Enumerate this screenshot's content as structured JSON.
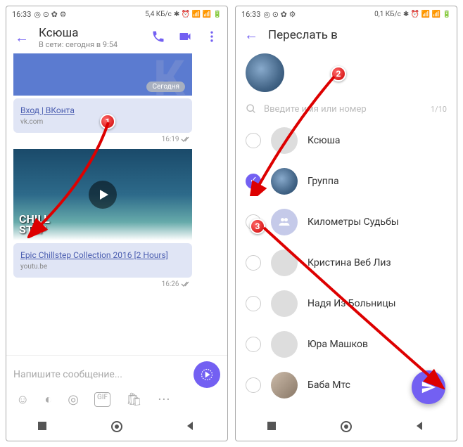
{
  "left": {
    "status": {
      "time": "16:33",
      "net": "5,4 КБ/с"
    },
    "header": {
      "title": "Ксюша",
      "sub": "В сети: сегодня в 9:54"
    },
    "date_chip": "Сегодня",
    "msg1": {
      "link": "Вход | ВКонта",
      "src": "vk.com",
      "time": "16:19"
    },
    "video": {
      "overlay1": "CHILL",
      "overlay2": "STEP",
      "link": "Epic Chillstep Collection 2016 [2 Hours]",
      "src": "youtu.be",
      "time": "16:26"
    },
    "input_placeholder": "Напишите сообщение...",
    "gif_label": "GIF"
  },
  "right": {
    "status": {
      "time": "16:33",
      "net": "0,1 КБ/с"
    },
    "header": {
      "title": "Переслать в"
    },
    "search": {
      "placeholder": "Введите имя или номер",
      "count": "1/10"
    },
    "contacts": [
      {
        "name": "Ксюша",
        "checked": false,
        "avatar": "blank"
      },
      {
        "name": "Группа",
        "checked": true,
        "avatar": "car"
      },
      {
        "name": "Километры Судьбы",
        "checked": false,
        "avatar": "grp"
      },
      {
        "name": "Кристина Веб Лиз",
        "checked": false,
        "avatar": "blank"
      },
      {
        "name": "Надя Из Больницы",
        "checked": false,
        "avatar": "blank"
      },
      {
        "name": "Юра Машков",
        "checked": false,
        "avatar": "blank"
      },
      {
        "name": "Баба Мтс",
        "checked": false,
        "avatar": "photo"
      }
    ]
  },
  "markers": {
    "m1": "1",
    "m2": "2",
    "m3": "3"
  }
}
